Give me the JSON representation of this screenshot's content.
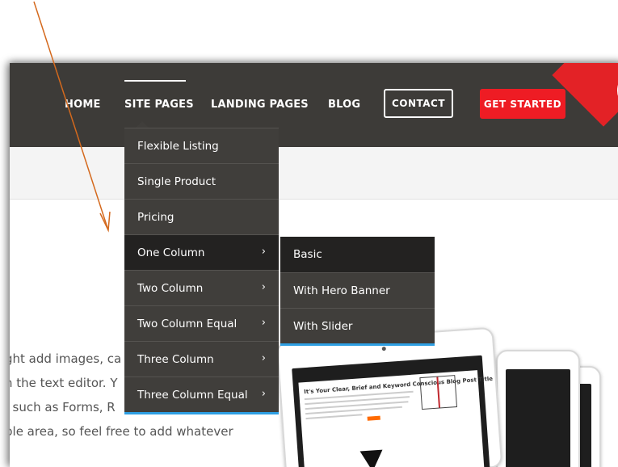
{
  "nav": {
    "items": [
      "HOME",
      "SITE PAGES",
      "LANDING PAGES",
      "BLOG"
    ],
    "active": "SITE PAGES",
    "contact_label": "CONTACT",
    "get_started_label": "GET STARTED"
  },
  "dropdown": {
    "items": [
      {
        "label": "Flexible Listing",
        "has_submenu": false
      },
      {
        "label": "Single Product",
        "has_submenu": false
      },
      {
        "label": "Pricing",
        "has_submenu": false
      },
      {
        "label": "One Column",
        "has_submenu": true
      },
      {
        "label": "Two Column",
        "has_submenu": true
      },
      {
        "label": "Two Column Equal",
        "has_submenu": true
      },
      {
        "label": "Three Column",
        "has_submenu": true
      },
      {
        "label": "Three Column Equal",
        "has_submenu": true
      }
    ],
    "active_item": "One Column",
    "submenu_items": [
      "Basic",
      "With Hero Banner",
      "With Slider"
    ]
  },
  "body_text": {
    "lines": [
      "ght add images, ca",
      "n the text editor. Y",
      ", such as Forms, R",
      "ble area, so feel free to add whatever"
    ]
  },
  "tablet_screen": {
    "blog_title": "It's Your Clear, Brief and Keyword Conscious Blog Post Title"
  },
  "colors": {
    "navbar_bg": "#3d3b38",
    "menu_bg": "#403e3b",
    "menu_active_bg": "#232221",
    "accent_red": "#ee1c24",
    "menu_underline_blue": "#2e9fe3",
    "annotation_arrow": "#d4691d"
  },
  "icons": {
    "submenu_indicator": "chevron-right-icon"
  }
}
